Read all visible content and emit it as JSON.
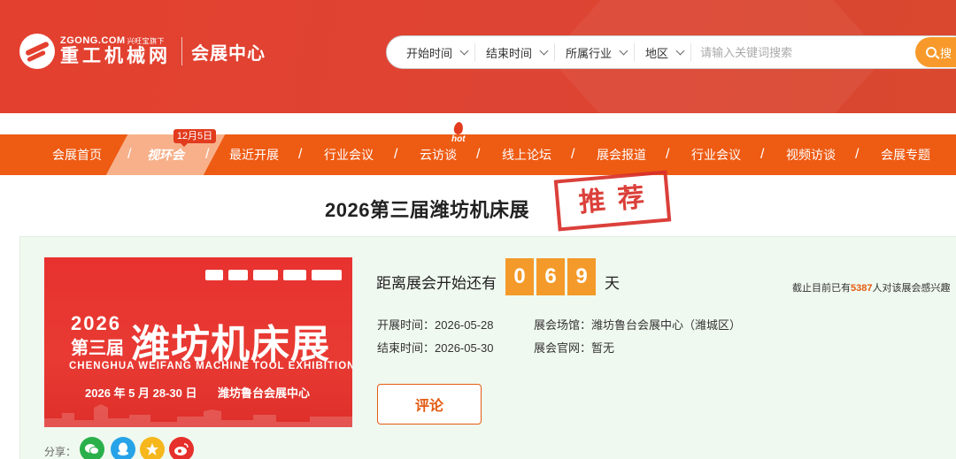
{
  "header": {
    "logo_top": "ZGONG.COM",
    "logo_slogan": "兴旺宝旗下",
    "logo_name": "重工机械网",
    "logo_sub": "会展中心",
    "filters": [
      "开始时间",
      "结束时间",
      "所属行业",
      "地区"
    ],
    "search_placeholder": "请输入关键词搜索",
    "search_button": "搜"
  },
  "nav": {
    "items": [
      "会展首页",
      "视环会",
      "最近开展",
      "行业会议",
      "云访谈",
      "线上论坛",
      "展会报道",
      "行业会议",
      "视频访谈",
      "会展专题"
    ],
    "separator": "/",
    "badge": "12月5日",
    "hot_label": "hot"
  },
  "page": {
    "title": "2026第三届潍坊机床展",
    "stamp": "推荐"
  },
  "poster": {
    "year": "2026",
    "edition": "第三届",
    "name": "潍坊机床展",
    "english": "CHENGHUA WEIFANG MACHINE TOOL EXHIBITION",
    "date": "2026 年 5 月 28-30 日",
    "venue": "潍坊鲁台会展中心"
  },
  "countdown": {
    "label": "距离展会开始还有",
    "digits": [
      "0",
      "6",
      "9"
    ],
    "unit": "天"
  },
  "interest": {
    "prefix": "截止目前已有",
    "count": "5387",
    "suffix": "人对该展会感兴趣"
  },
  "info": {
    "open_label": "开展时间：",
    "open_value": "2026-05-28",
    "close_label": "结束时间：",
    "close_value": "2026-05-30",
    "venue_label": "展会场馆：",
    "venue_value": "潍坊鲁台会展中心（潍城区）",
    "site_label": "展会官网：",
    "site_value": "暂无"
  },
  "actions": {
    "comment": "评论",
    "share_label": "分享："
  },
  "share_icons": [
    "wechat-icon",
    "qq-icon",
    "qzone-icon",
    "weibo-icon"
  ],
  "colors": {
    "header_red": "#e4402f",
    "nav_orange": "#ee5b13",
    "digit_orange": "#f39a2a",
    "panel_green": "#f0f9ef",
    "stamp_red": "#d8302a"
  }
}
